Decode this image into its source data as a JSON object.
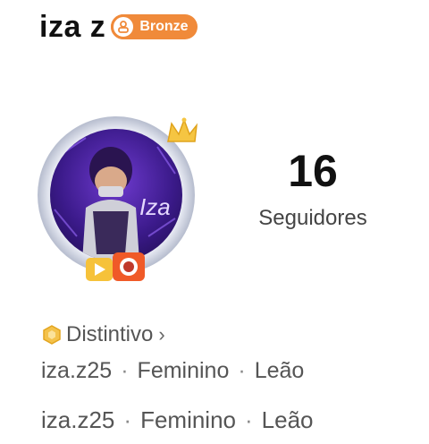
{
  "profile": {
    "name": "iza z",
    "level_badge": {
      "label": "Bronze",
      "color": "#f08a3a",
      "icon": "bronze-badge-icon"
    },
    "avatar": {
      "icon": "avatar-image",
      "avatar_text": "Iza",
      "decorations": [
        "crown-icon",
        "camera-icon",
        "video-icon"
      ]
    }
  },
  "stats": {
    "followers": {
      "value": "16",
      "label": "Seguidores"
    }
  },
  "badges_link": {
    "label": "Distintivo",
    "icon": "hexagon-badge-icon",
    "chevron": "›"
  },
  "info_lines": [
    {
      "handle": "iza.z25",
      "gender": "Feminino",
      "sign": "Leão",
      "separator": "·"
    },
    {
      "handle": "iza.z25",
      "gender": "Feminino",
      "sign": "Leão",
      "separator": "·"
    }
  ]
}
